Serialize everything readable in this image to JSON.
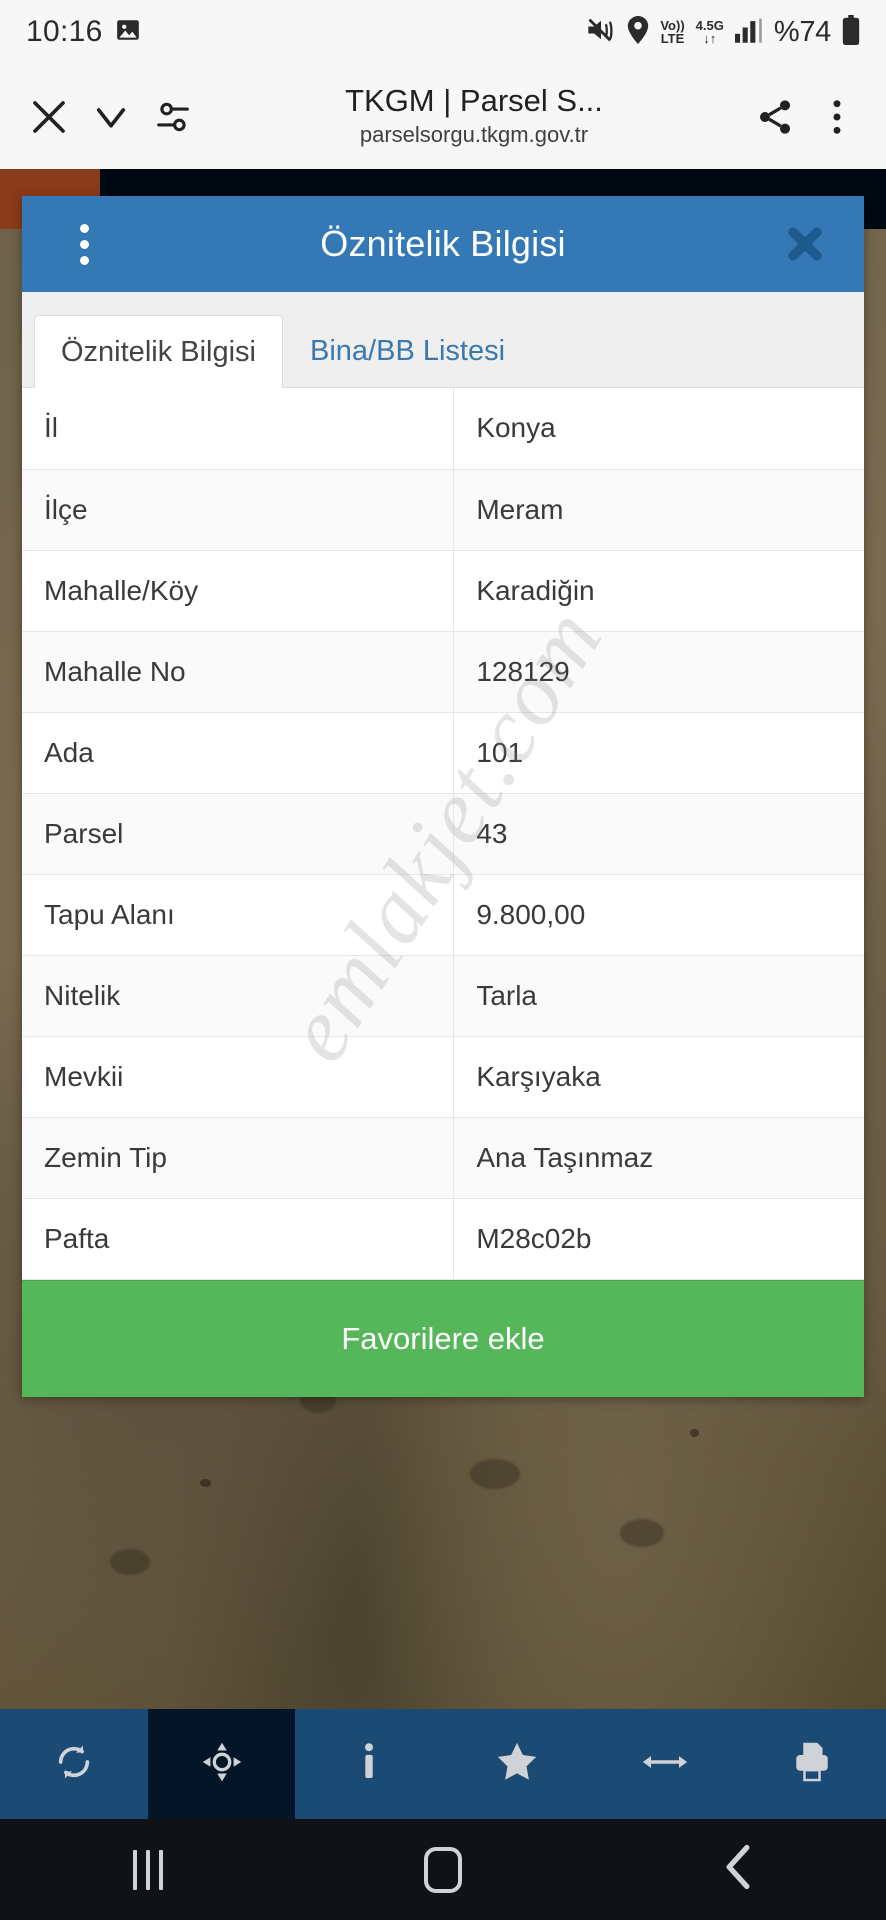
{
  "status_bar": {
    "time": "10:16",
    "icons": [
      "image-icon",
      "mute-icon",
      "location-icon",
      "volte-icon",
      "network-4.5g-icon",
      "signal-icon",
      "battery-icon"
    ],
    "volte_top": "Vo))",
    "volte_bottom": "LTE",
    "network_top": "4.5G",
    "network_bottom": "↓↑",
    "battery_percent": "%74"
  },
  "browser": {
    "close_label": "×",
    "expand_label": "⌄",
    "page_info_label": "page-info",
    "title": "TKGM | Parsel S...",
    "url": "parselsorgu.tkgm.gov.tr",
    "share_label": "share",
    "menu_label": "menu"
  },
  "dialog": {
    "title": "Öznitelik Bilgisi",
    "menu_label": "kebab-menu",
    "close_label": "×",
    "tabs": [
      {
        "label": "Öznitelik Bilgisi",
        "active": true
      },
      {
        "label": "Bina/BB Listesi",
        "active": false
      }
    ],
    "rows": [
      {
        "key": "İl",
        "value": "Konya"
      },
      {
        "key": "İlçe",
        "value": "Meram"
      },
      {
        "key": "Mahalle/Köy",
        "value": "Karadiğin"
      },
      {
        "key": "Mahalle No",
        "value": "128129"
      },
      {
        "key": "Ada",
        "value": "101"
      },
      {
        "key": "Parsel",
        "value": "43"
      },
      {
        "key": "Tapu Alanı",
        "value": "9.800,00"
      },
      {
        "key": "Nitelik",
        "value": "Tarla"
      },
      {
        "key": "Mevkii",
        "value": "Karşıyaka"
      },
      {
        "key": "Zemin Tip",
        "value": "Ana Taşınmaz"
      },
      {
        "key": "Pafta",
        "value": "M28c02b"
      }
    ],
    "favorite_button": "Favorilere ekle",
    "watermark": "emlakjet.com",
    "header_color": "#3479b5",
    "favorite_color": "#56b65a"
  },
  "bottom_toolbar": {
    "items": [
      {
        "icon": "refresh-icon",
        "active": false
      },
      {
        "icon": "crosshair-locate-icon",
        "active": true
      },
      {
        "icon": "info-icon",
        "active": false
      },
      {
        "icon": "star-icon",
        "active": false
      },
      {
        "icon": "measure-arrows-icon",
        "active": false
      },
      {
        "icon": "print-icon",
        "active": false
      }
    ],
    "background_color": "#1b4a75",
    "active_color": "#041528"
  },
  "android_nav": {
    "recents_label": "recents",
    "home_label": "home",
    "back_label": "back"
  }
}
